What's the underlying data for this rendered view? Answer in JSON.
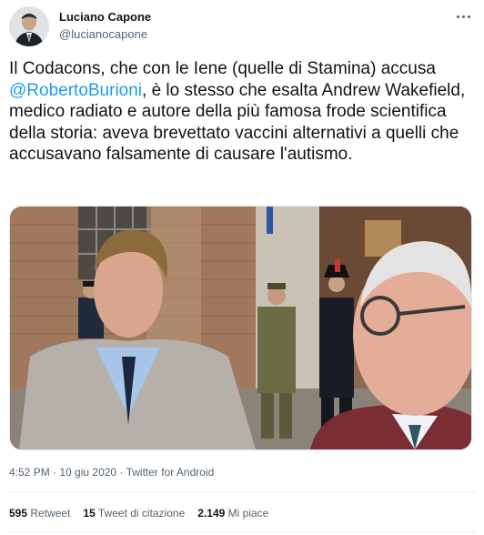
{
  "author": {
    "name": "Luciano Capone",
    "handle": "@lucianocapone"
  },
  "tweet": {
    "text_before": "Il Codacons, che con le Iene (quelle di Stamina) accusa ",
    "mention": "@RobertoBurioni",
    "text_after": ", è lo stesso che esalta Andrew Wakefield, medico radiato e autore della più famosa frode scientifica della storia: aveva brevettato vaccini alternativi a quelli che accusavano falsamente di causare l'autismo."
  },
  "meta": {
    "time": "4:52 PM",
    "separator1": " · ",
    "date": "10 giu 2020",
    "separator2": " · ",
    "source": "Twitter for Android"
  },
  "stats": {
    "retweets_count": "595",
    "retweets_label": "Retweet",
    "quotes_count": "15",
    "quotes_label": "Tweet di citazione",
    "likes_count": "2.149",
    "likes_label": "Mi piace"
  },
  "colors": {
    "link": "#1d9bf0",
    "text": "#0f1419",
    "secondary": "#536471"
  },
  "icons": {
    "more": "more-horizontal-icon"
  }
}
